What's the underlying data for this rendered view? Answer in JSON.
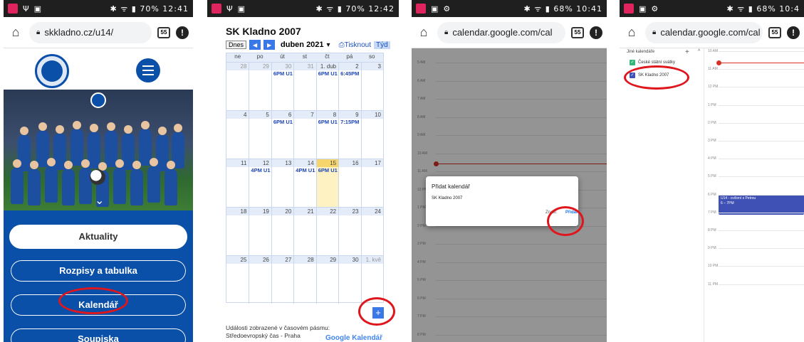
{
  "status": {
    "p1_time": "12:41",
    "p1_battery": "70%",
    "p2_time": "12:42",
    "p2_battery": "70%",
    "p3_time": "10:41",
    "p3_battery": "68%",
    "p4_time": "10:4",
    "p4_battery": "68%"
  },
  "p1": {
    "url": "skkladno.cz/u14/",
    "tabs_count": "55",
    "nav": [
      {
        "label": "Aktuality"
      },
      {
        "label": "Rozpisy a tabulka"
      },
      {
        "label": "Kalendář"
      },
      {
        "label": "Soupiska"
      }
    ]
  },
  "p2": {
    "title": "SK Kladno 2007",
    "today_label": "Dnes",
    "prev_icon": "◀",
    "next_icon": "▶",
    "month": "duben 2021",
    "print_label": "Tisknout",
    "week_label": "Týd",
    "dow": [
      "ne",
      "po",
      "út",
      "st",
      "čt",
      "pá",
      "so"
    ],
    "weeks": [
      [
        {
          "d": "28",
          "other": true
        },
        {
          "d": "29",
          "other": true
        },
        {
          "d": "30",
          "other": true,
          "ev": "6PM U1"
        },
        {
          "d": "31",
          "other": true
        },
        {
          "d": "1. dub",
          "ev": "6PM U1"
        },
        {
          "d": "2",
          "ev": "6:45PM"
        },
        {
          "d": "3"
        }
      ],
      [
        {
          "d": "4"
        },
        {
          "d": "5"
        },
        {
          "d": "6",
          "ev": "6PM U1"
        },
        {
          "d": "7"
        },
        {
          "d": "8",
          "ev": "6PM U1"
        },
        {
          "d": "9",
          "ev": "7:15PM"
        },
        {
          "d": "10"
        }
      ],
      [
        {
          "d": "11"
        },
        {
          "d": "12",
          "ev": "4PM U1"
        },
        {
          "d": "13"
        },
        {
          "d": "14",
          "ev": "4PM U1"
        },
        {
          "d": "15",
          "today": true,
          "ev": "6PM U1"
        },
        {
          "d": "16"
        },
        {
          "d": "17"
        }
      ],
      [
        {
          "d": "18"
        },
        {
          "d": "19"
        },
        {
          "d": "20"
        },
        {
          "d": "21"
        },
        {
          "d": "22"
        },
        {
          "d": "23"
        },
        {
          "d": "24"
        }
      ],
      [
        {
          "d": "25"
        },
        {
          "d": "26"
        },
        {
          "d": "27"
        },
        {
          "d": "28"
        },
        {
          "d": "29"
        },
        {
          "d": "30"
        },
        {
          "d": "1. kvě",
          "other": true
        }
      ]
    ],
    "footer": "Události zobrazené v časovém pásmu: Středoevropský čas - Praha",
    "gcal_logo": "Google Kalendář",
    "plus": "+"
  },
  "p3": {
    "url": "calendar.google.com/cal",
    "tabs_count": "55",
    "hours": [
      "5 AM",
      "6 AM",
      "7 AM",
      "8 AM",
      "9 AM",
      "10 AM",
      "11 AM",
      "12 PM",
      "1 PM",
      "2 PM",
      "3 PM",
      "4 PM",
      "5 PM",
      "6 PM",
      "7 PM",
      "8 PM"
    ],
    "dialog_title": "Přidat kalendář",
    "dialog_calendar": "SK Kladno 2007",
    "cancel": "Zrušit",
    "add": "Přidat"
  },
  "p4": {
    "url": "calendar.google.com/cal",
    "tabs_count": "55",
    "other_calendars": "Jiné kalendáře",
    "add_icon": "+",
    "collapse_icon": "^",
    "cal_items": [
      {
        "label": "České státní svátky",
        "color": "#33b679"
      },
      {
        "label": "SK Kladno 2007",
        "color": "#3f51b5"
      }
    ],
    "hours": [
      "10 AM",
      "11 AM",
      "12 PM",
      "1 PM",
      "2 PM",
      "3 PM",
      "4 PM",
      "5 PM",
      "6 PM",
      "7 PM",
      "8 PM",
      "9 PM",
      "10 PM",
      "11 PM"
    ],
    "event_title": "U14 - cvičení s Petrou",
    "event_time": "6 – 7PM"
  }
}
